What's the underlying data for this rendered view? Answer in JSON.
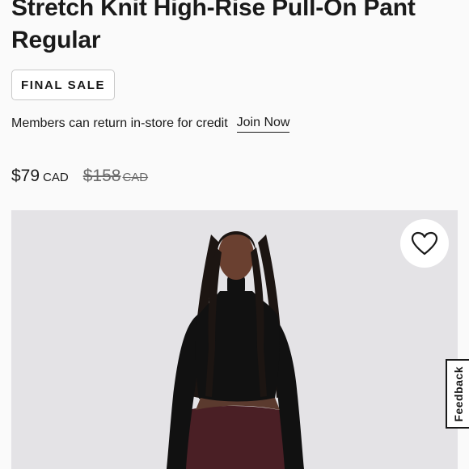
{
  "product": {
    "title": "Stretch Knit High-Rise Pull-On Pant Regular",
    "badge": "FINAL SALE"
  },
  "membership": {
    "message": "Members can return in-store for credit",
    "link_label": "Join Now"
  },
  "price": {
    "sale_amount": "$79",
    "sale_currency": "CAD",
    "original_amount": "$158",
    "original_currency": "CAD"
  },
  "image": {
    "background_color": "#e4e3e6",
    "top_color": "#111111",
    "pant_color": "#4a1f25"
  },
  "wishlist": {
    "icon": "heart-outline-icon"
  },
  "feedback": {
    "label": "Feedback"
  }
}
